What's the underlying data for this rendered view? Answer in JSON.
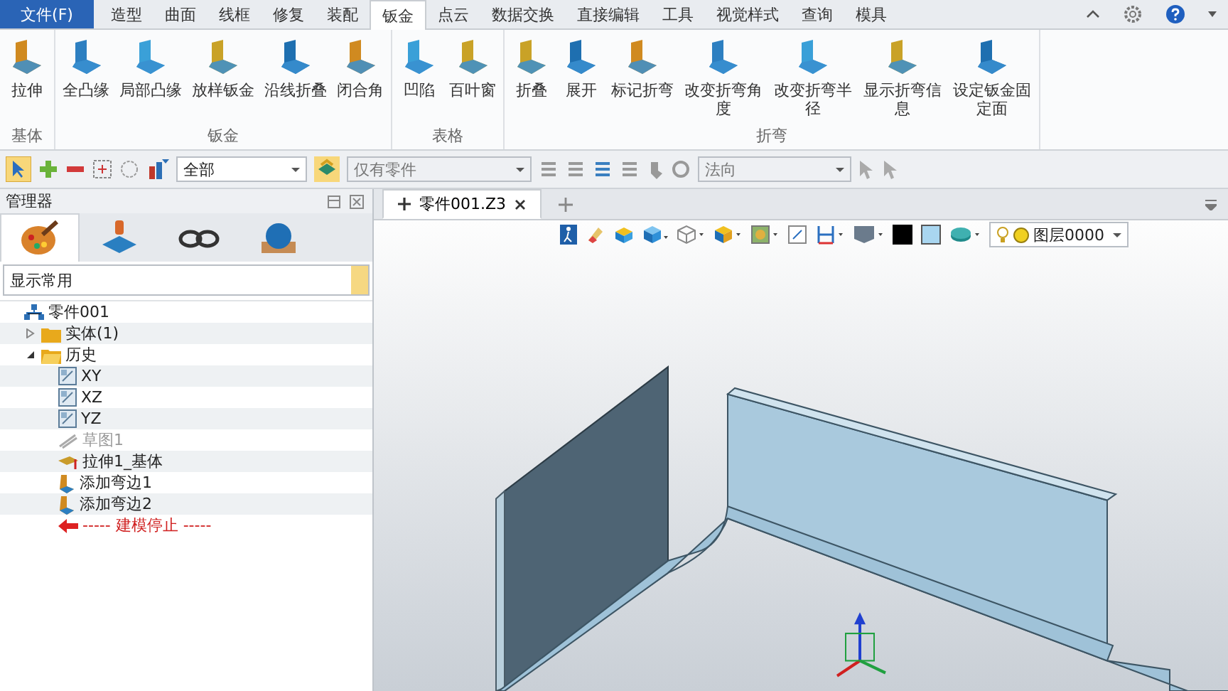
{
  "menu": {
    "file_button": "文件(F)",
    "tabs": [
      {
        "label": "造型",
        "selected": false
      },
      {
        "label": "曲面",
        "selected": false
      },
      {
        "label": "线框",
        "selected": false
      },
      {
        "label": "修复",
        "selected": false
      },
      {
        "label": "装配",
        "selected": false
      },
      {
        "label": "钣金",
        "selected": true
      },
      {
        "label": "点云",
        "selected": false
      },
      {
        "label": "数据交换",
        "selected": false
      },
      {
        "label": "直接编辑",
        "selected": false
      },
      {
        "label": "工具",
        "selected": false
      },
      {
        "label": "视觉样式",
        "selected": false
      },
      {
        "label": "查询",
        "selected": false
      },
      {
        "label": "模具",
        "selected": false
      }
    ]
  },
  "ribbon": {
    "groups": [
      {
        "label": "基体",
        "buttons": [
          "拉伸"
        ]
      },
      {
        "label": "钣金",
        "buttons": [
          "全凸缘",
          "局部凸缘",
          "放样钣金",
          "沿线折叠",
          "闭合角"
        ]
      },
      {
        "label": "表格",
        "buttons": [
          "凹陷",
          "百叶窗"
        ]
      },
      {
        "label": "折弯",
        "buttons": [
          "折叠",
          "展开",
          "标记折弯",
          "改变折弯角度",
          "改变折弯半径",
          "显示折弯信息",
          "设定钣金固定面"
        ]
      }
    ]
  },
  "toolbar": {
    "filter_combo": "全部",
    "part_combo": "仅有零件",
    "direction_combo": "法向"
  },
  "manager": {
    "title": "管理器",
    "tabs": [
      {
        "selected": true
      },
      {
        "selected": false
      },
      {
        "selected": false
      },
      {
        "selected": false
      }
    ],
    "display_combo": "显示常用",
    "tree": [
      {
        "label": "零件001",
        "kind": "part",
        "children": [
          {
            "label": "实体(1)",
            "kind": "folder",
            "expanded": false
          },
          {
            "label": "历史",
            "kind": "folder",
            "expanded": true,
            "children": [
              {
                "label": "XY",
                "kind": "plane",
                "disabled": false
              },
              {
                "label": "XZ",
                "kind": "plane",
                "disabled": false
              },
              {
                "label": "YZ",
                "kind": "plane",
                "disabled": false
              },
              {
                "label": "草图1",
                "kind": "sketch",
                "disabled": true
              },
              {
                "label": "拉伸1_基体",
                "kind": "extrude",
                "disabled": false
              },
              {
                "label": "添加弯边1",
                "kind": "flange",
                "disabled": false
              },
              {
                "label": "添加弯边2",
                "kind": "flange",
                "disabled": false
              },
              {
                "label": "----- 建模停止 -----",
                "kind": "stop",
                "disabled": false
              }
            ]
          }
        ]
      }
    ]
  },
  "document": {
    "tab": {
      "label": "零件001.Z3",
      "selected": true
    },
    "layer_combo": "图层0000"
  }
}
